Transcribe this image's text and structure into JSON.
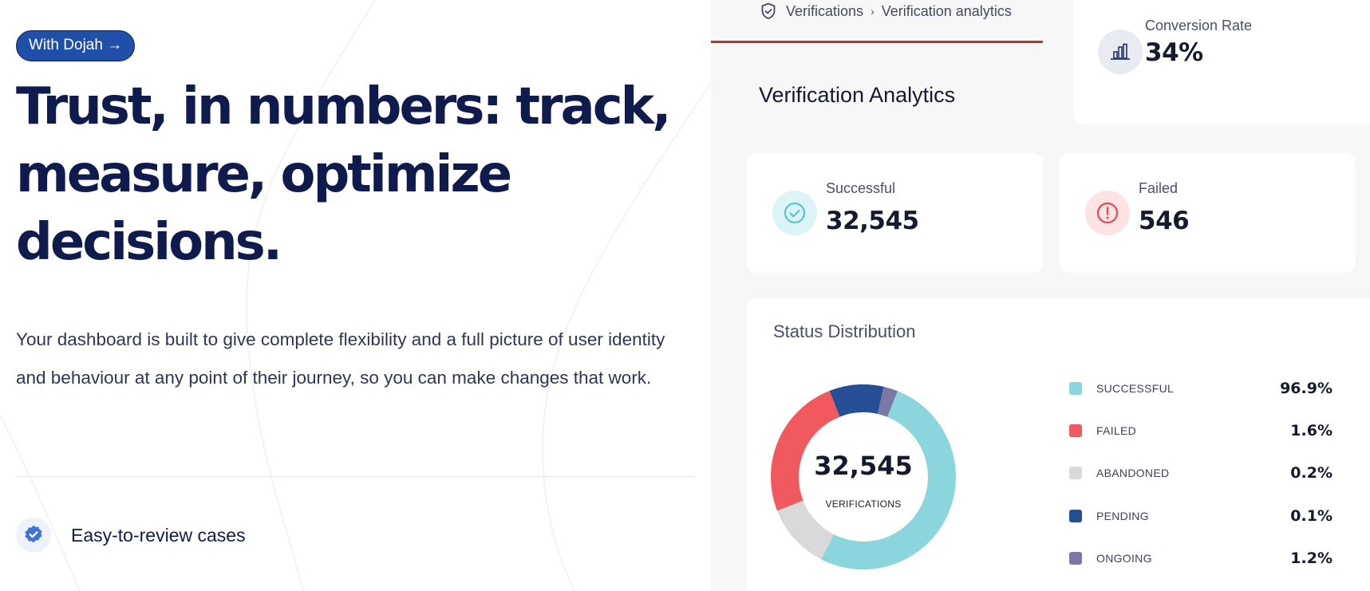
{
  "hero": {
    "pill_label": "With Dojah →",
    "headline": "Trust, in numbers: track, measure, optimize decisions.",
    "description": "Your dashboard is built to give complete flexibility and a full picture of user identity and behaviour at any point of their journey, so you can make changes that work.",
    "feature_label": "Easy-to-review cases",
    "feature_icon": "verified-badge-icon"
  },
  "dashboard": {
    "breadcrumb": {
      "icon": "shield-check-icon",
      "items": [
        "Verifications",
        "Verification analytics"
      ],
      "separator": "›"
    },
    "title": "Verification Analytics",
    "conversion": {
      "label": "Conversion Rate",
      "value": "34%",
      "icon": "bar-chart-icon"
    },
    "successful": {
      "label": "Successful",
      "value": "32,545",
      "icon": "check-circle-icon"
    },
    "failed": {
      "label": "Failed",
      "value": "546",
      "icon": "alert-circle-icon"
    },
    "status": {
      "title": "Status Distribution",
      "total": "32,545",
      "caption": "VERIFICATIONS",
      "legend": [
        {
          "label": "SUCCESSFUL",
          "pct": "96.9%",
          "color": "#8bd6dc"
        },
        {
          "label": "FAILED",
          "pct": "1.6%",
          "color": "#f05a5e"
        },
        {
          "label": "ABANDONED",
          "pct": "0.2%",
          "color": "#d9d9d9"
        },
        {
          "label": "PENDING",
          "pct": "0.1%",
          "color": "#254e94"
        },
        {
          "label": "ONGOING",
          "pct": "1.2%",
          "color": "#7b78a6"
        }
      ],
      "donut_segments": [
        {
          "status": "SUCCESSFUL",
          "share": 0.515,
          "color": "#8bd6dc"
        },
        {
          "status": "ABANDONED",
          "share": 0.115,
          "color": "#d9d9d9"
        },
        {
          "status": "FAILED",
          "share": 0.25,
          "color": "#f05a5e"
        },
        {
          "status": "PENDING",
          "share": 0.095,
          "color": "#254e94"
        },
        {
          "status": "ONGOING",
          "share": 0.025,
          "color": "#7b78a6"
        }
      ]
    }
  },
  "colors": {
    "brand_navy": "#0f1b4d",
    "pill_blue": "#1f4fa8",
    "accent_red": "#b13a3a",
    "success_tint": "#dcf4f5",
    "failed_tint": "#fde3e3"
  }
}
